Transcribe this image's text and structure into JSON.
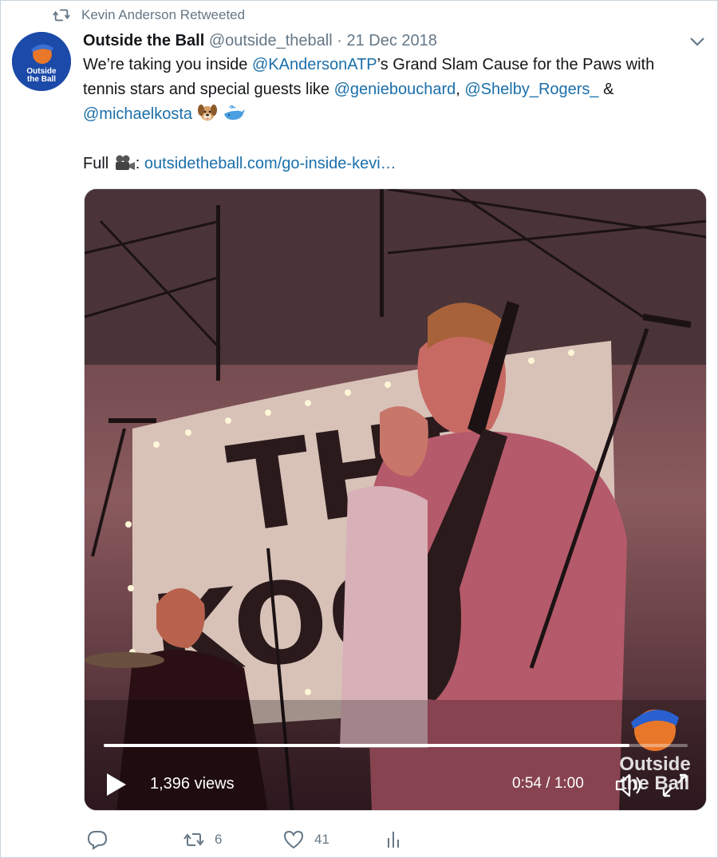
{
  "retweet": {
    "icon": "retweet-icon",
    "label": "Kevin Anderson Retweeted"
  },
  "author": {
    "avatar_icon": "outside-the-ball-logo",
    "avatar_text_1": "Outside",
    "avatar_text_2": "the Ball",
    "name": "Outside the Ball",
    "handle": "@outside_theball",
    "separator": "·",
    "date": "21 Dec 2018"
  },
  "tweet": {
    "line1_prefix": "We’re taking you inside ",
    "mention_1": "@KAndersonATP",
    "line1_suffix": "’s Grand Slam Cause for the Paws with",
    "line2_prefix": "tennis stars and special guests like ",
    "mention_2": "@geniebouchard",
    "comma": ", ",
    "mention_3": "@Shelby_Rogers_",
    "amp": " &",
    "mention_4": "@michaelkosta",
    "emojis": [
      "dog-face-emoji",
      "whale-emoji"
    ],
    "full_label": "Full ",
    "camera_emoji": "movie-camera-emoji",
    "colon": ": ",
    "link": "outsidetheball.com/go-inside-kevi…"
  },
  "video": {
    "views": "1,396 views",
    "time": "0:54 / 1:00",
    "progress": 0.9,
    "watermark_text_1": "Outside",
    "watermark_text_2": "the Ball",
    "banner_text_1": "THE",
    "banner_text_2": "KOOK",
    "play_icon": "play-icon",
    "volume_icon": "volume-icon",
    "fullscreen_icon": "fullscreen-icon"
  },
  "actions": {
    "reply_icon": "reply-icon",
    "retweet_icon": "retweet-icon",
    "retweet_count": "6",
    "like_icon": "heart-icon",
    "like_count": "41",
    "analytics_icon": "analytics-icon"
  },
  "colors": {
    "link": "#1b6faa",
    "muted": "#657786",
    "text": "#14171a",
    "avatar_bg": "#1b4aa8"
  }
}
